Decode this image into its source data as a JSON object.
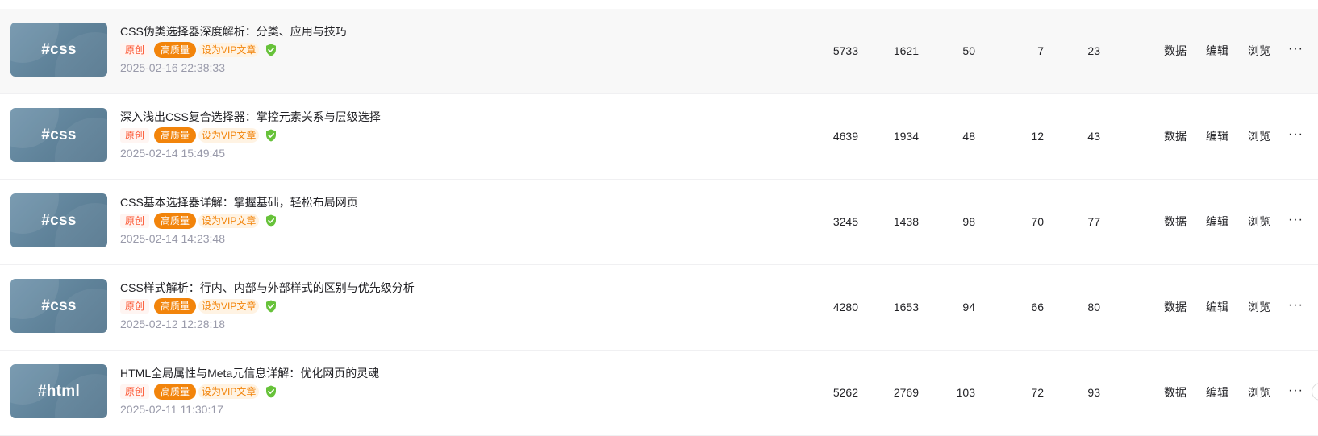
{
  "articles": [
    {
      "thumb_tag": "#css",
      "title": "CSS伪类选择器深度解析：分类、应用与技巧",
      "badges": {
        "original": "原创",
        "quality": "高质量",
        "vip": "设为VIP文章"
      },
      "date": "2025-02-16 22:38:33",
      "stats": [
        "5733",
        "1621",
        "50",
        "7",
        "23"
      ],
      "actions": {
        "data": "数据",
        "edit": "编辑",
        "browse": "浏览",
        "more": "···"
      }
    },
    {
      "thumb_tag": "#css",
      "title": "深入浅出CSS复合选择器：掌控元素关系与层级选择",
      "badges": {
        "original": "原创",
        "quality": "高质量",
        "vip": "设为VIP文章"
      },
      "date": "2025-02-14 15:49:45",
      "stats": [
        "4639",
        "1934",
        "48",
        "12",
        "43"
      ],
      "actions": {
        "data": "数据",
        "edit": "编辑",
        "browse": "浏览",
        "more": "···"
      }
    },
    {
      "thumb_tag": "#css",
      "title": "CSS基本选择器详解：掌握基础，轻松布局网页",
      "badges": {
        "original": "原创",
        "quality": "高质量",
        "vip": "设为VIP文章"
      },
      "date": "2025-02-14 14:23:48",
      "stats": [
        "3245",
        "1438",
        "98",
        "70",
        "77"
      ],
      "actions": {
        "data": "数据",
        "edit": "编辑",
        "browse": "浏览",
        "more": "···"
      }
    },
    {
      "thumb_tag": "#css",
      "title": "CSS样式解析：行内、内部与外部样式的区别与优先级分析",
      "badges": {
        "original": "原创",
        "quality": "高质量",
        "vip": "设为VIP文章"
      },
      "date": "2025-02-12 12:28:18",
      "stats": [
        "4280",
        "1653",
        "94",
        "66",
        "80"
      ],
      "actions": {
        "data": "数据",
        "edit": "编辑",
        "browse": "浏览",
        "more": "···"
      }
    },
    {
      "thumb_tag": "#html",
      "title": "HTML全局属性与Meta元信息详解：优化网页的灵魂",
      "badges": {
        "original": "原创",
        "quality": "高质量",
        "vip": "设为VIP文章"
      },
      "date": "2025-02-11 11:30:17",
      "stats": [
        "5262",
        "2769",
        "103",
        "72",
        "93"
      ],
      "actions": {
        "data": "数据",
        "edit": "编辑",
        "browse": "浏览",
        "more": "···"
      }
    }
  ],
  "icons": {
    "verified": "shield-check-icon",
    "more": "more-dots-icon"
  },
  "colors": {
    "original_badge": "#fc5531",
    "quality_badge": "#f2840b",
    "vip_badge": "#f2840b",
    "verified_icon": "#67c23a",
    "thumb_bg": "#6489a1",
    "hover_row": "#f8f8f8"
  }
}
